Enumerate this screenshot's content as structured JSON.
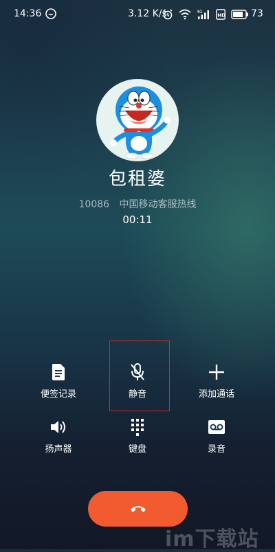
{
  "status_bar": {
    "time": "14:36",
    "network_speed": "3.12 K/s",
    "battery_percent": "73",
    "icons": [
      "app-notification-icon",
      "alarm-icon",
      "wifi-icon",
      "signal-4g-icon",
      "hd-icon",
      "battery-icon"
    ]
  },
  "contact": {
    "name": "包租婆",
    "number": "10086",
    "label": "中国移动客服热线",
    "duration": "00:11",
    "avatar": "doraemon-avatar"
  },
  "controls": [
    {
      "label": "便签记录",
      "icon": "note-icon"
    },
    {
      "label": "静音",
      "icon": "mute-microphone-icon"
    },
    {
      "label": "添加通话",
      "icon": "add-call-icon"
    },
    {
      "label": "扬声器",
      "icon": "speaker-icon"
    },
    {
      "label": "键盘",
      "icon": "keypad-icon"
    },
    {
      "label": "录音",
      "icon": "record-icon"
    }
  ],
  "hangup": {
    "icon": "hangup-phone-icon",
    "color": "#f25a2f"
  },
  "highlight": {
    "target": "静音",
    "color": "#d32a25"
  },
  "watermark": "im下载站"
}
